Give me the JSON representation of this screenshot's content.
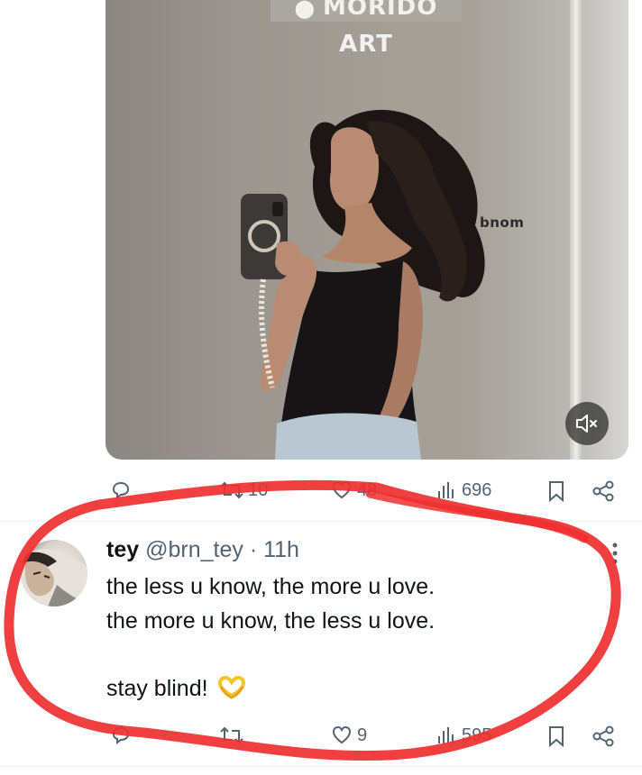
{
  "top_post": {
    "media": {
      "alt": "",
      "sign_text": "MORIDO ART",
      "wall_logo_text": "bnom",
      "mute_button_icon": "volume-muted-icon"
    },
    "actions": {
      "reply_count": "",
      "retweet_count": "10",
      "like_count": "48",
      "views_count": "696"
    }
  },
  "tweet": {
    "display_name": "tey",
    "handle": "@brn_tey",
    "separator": "·",
    "timestamp": "11h",
    "lines": [
      "the less u know, the more u love.",
      "the more u know, the less u love."
    ],
    "last_line": "stay blind!",
    "emoji": "🫶",
    "actions": {
      "reply_count": "",
      "retweet_count": "",
      "like_count": "9",
      "views_count": "595"
    }
  },
  "icons": {
    "reply": "reply-icon",
    "retweet": "retweet-icon",
    "like": "heart-icon",
    "views": "views-bar-chart-icon",
    "bookmark": "bookmark-icon",
    "share": "share-icon",
    "more": "more-vertical-icon",
    "mute": "volume-muted-icon"
  },
  "colors": {
    "text_primary": "#0f1419",
    "text_secondary": "#536471",
    "divider": "#eff3f4",
    "annotation_red": "#ee2f2f",
    "emoji_yellow": "#f6c32b"
  }
}
